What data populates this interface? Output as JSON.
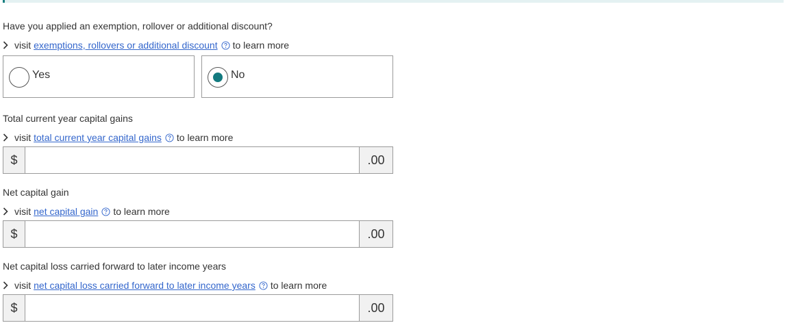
{
  "colors": {
    "accent": "#137a7f",
    "link": "#3366cc",
    "border": "#9a9a9a",
    "addon_bg": "#f1f1f1",
    "top_bar": "#e4f1f2"
  },
  "icons": {
    "chevron": "chevron-right-icon",
    "help": "question-circle-icon"
  },
  "exemption": {
    "label": "Have you applied an exemption, rollover or additional discount?",
    "visit_prefix": "visit",
    "link_text": "exemptions, rollovers or additional discount",
    "visit_suffix": "to learn more",
    "options": [
      {
        "label": "Yes",
        "selected": false
      },
      {
        "label": "No",
        "selected": true
      }
    ]
  },
  "capital_gains": {
    "label": "Total current year capital gains",
    "visit_prefix": "visit",
    "link_text": "total current year capital gains",
    "visit_suffix": "to learn more",
    "prefix": "$",
    "value": "",
    "suffix": ".00"
  },
  "net_gain": {
    "label": "Net capital gain",
    "visit_prefix": "visit",
    "link_text": "net capital gain",
    "visit_suffix": "to learn more",
    "prefix": "$",
    "value": "",
    "suffix": ".00"
  },
  "net_loss": {
    "label": "Net capital loss carried forward to later income years",
    "visit_prefix": "visit",
    "link_text": "net capital loss carried forward to later income years",
    "visit_suffix": "to learn more",
    "prefix": "$",
    "value": "",
    "suffix": ".00"
  }
}
